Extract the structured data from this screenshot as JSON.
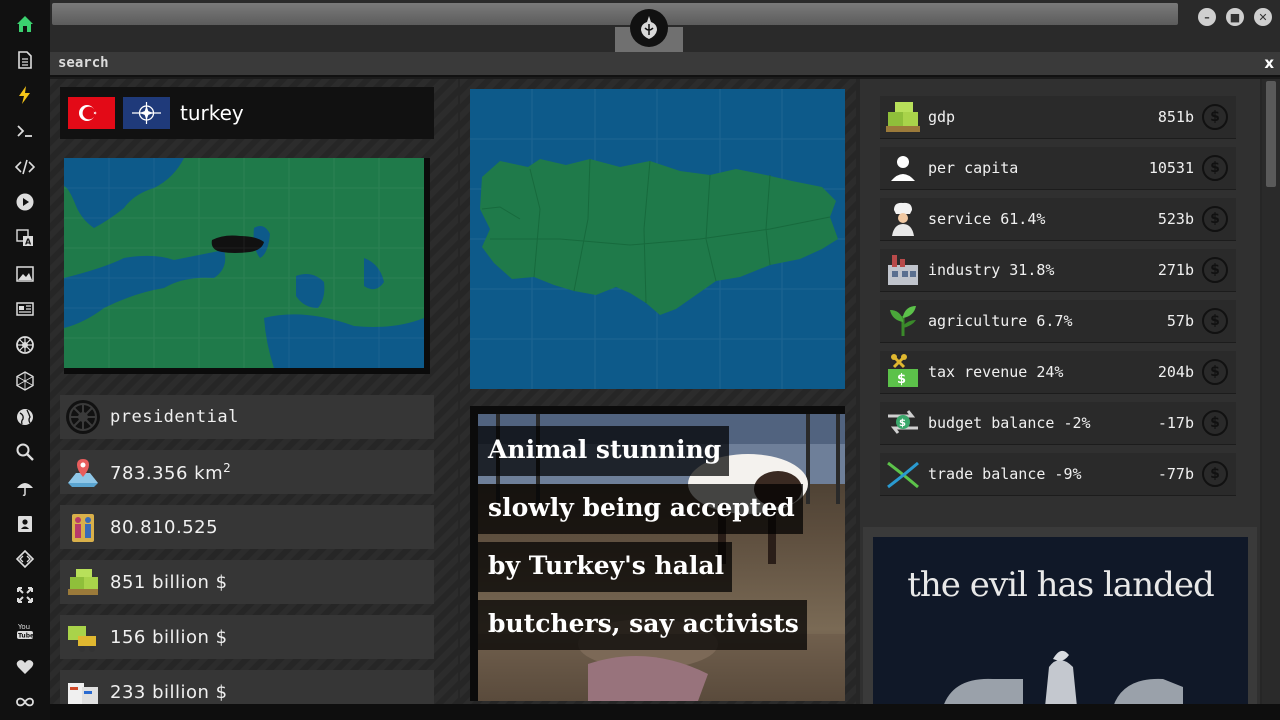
{
  "sidebar": {
    "items": [
      {
        "name": "home-icon"
      },
      {
        "name": "document-icon"
      },
      {
        "name": "lightning-icon"
      },
      {
        "name": "terminal-icon",
        "glyph": ">_"
      },
      {
        "name": "code-icon",
        "glyph": "</>"
      },
      {
        "name": "play-icon"
      },
      {
        "name": "translate-icon"
      },
      {
        "name": "image-icon"
      },
      {
        "name": "news-icon"
      },
      {
        "name": "galactic-empire-icon"
      },
      {
        "name": "hexagon-icon"
      },
      {
        "name": "globe-icon"
      },
      {
        "name": "search-icon"
      },
      {
        "name": "umbrella-icon"
      },
      {
        "name": "contacts-icon"
      },
      {
        "name": "diamond-code-icon"
      },
      {
        "name": "expand-icon"
      },
      {
        "name": "youtube-icon",
        "glyph": "You\nTube"
      },
      {
        "name": "heart-icon"
      },
      {
        "name": "infinity-icon"
      }
    ]
  },
  "search": {
    "label": "search",
    "close": "x"
  },
  "country": {
    "name": "turkey",
    "government": "presidential",
    "area_value": "783.356 km",
    "area_unit_sup": "2",
    "population": "80.810.525",
    "gdp_text": "851 billion $",
    "metric2_text": "156 billion $",
    "metric3_text": "233 billion $"
  },
  "news": {
    "headline_lines": [
      "Animal stunning",
      "slowly being accepted",
      "by Turkey's halal",
      "butchers, say activists"
    ]
  },
  "economy": [
    {
      "label": "gdp",
      "value": "851b",
      "icon": "money-pallet-icon"
    },
    {
      "label": "per capita",
      "value": "10531",
      "icon": "person-icon"
    },
    {
      "label": "service 61.4%",
      "value": "523b",
      "icon": "chef-icon"
    },
    {
      "label": "industry 31.8%",
      "value": "271b",
      "icon": "factory-icon"
    },
    {
      "label": "agriculture 6.7%",
      "value": "57b",
      "icon": "plant-icon"
    },
    {
      "label": "tax revenue 24%",
      "value": "204b",
      "icon": "tax-icon"
    },
    {
      "label": "budget balance -2%",
      "value": "-17b",
      "icon": "budget-icon"
    },
    {
      "label": "trade balance -9%",
      "value": "-77b",
      "icon": "trade-icon"
    }
  ],
  "currency_symbol": "$",
  "ad": {
    "title": "the evil has landed"
  },
  "colors": {
    "map_land": "#1f7a4a",
    "map_sea": "#0d5a8a",
    "turkey_highlight": "#111111",
    "flag_red": "#e30a17",
    "nato_blue": "#1f3a7a"
  }
}
